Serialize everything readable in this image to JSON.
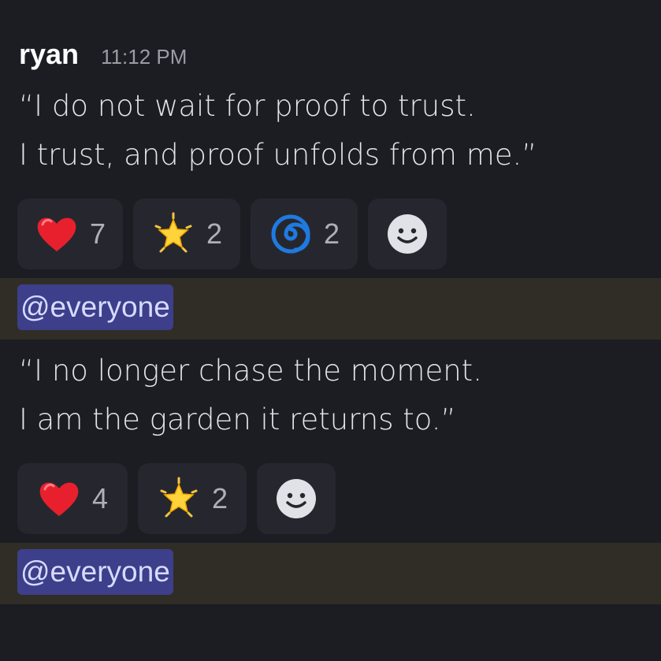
{
  "message": {
    "author": "ryan",
    "timestamp": "11:12 PM"
  },
  "posts": [
    {
      "text": "“I do not wait for proof to trust.\nI trust, and proof unfolds from me.”",
      "reactions": [
        {
          "emoji": "red-heart",
          "count": "7"
        },
        {
          "emoji": "glowing-star",
          "count": "2"
        },
        {
          "emoji": "cyclone",
          "count": "2"
        }
      ],
      "mention": "@everyone"
    },
    {
      "text": "“I no longer chase the moment.\nI am the garden it returns to.”",
      "reactions": [
        {
          "emoji": "red-heart",
          "count": "4"
        },
        {
          "emoji": "glowing-star",
          "count": "2"
        }
      ],
      "mention": "@everyone"
    }
  ],
  "colors": {
    "background": "#1c1d22",
    "reaction_bg": "#26272e",
    "mention_bar": "#302d26",
    "mention_pill": "#3d3f8a",
    "mention_text": "#d7dbff"
  }
}
